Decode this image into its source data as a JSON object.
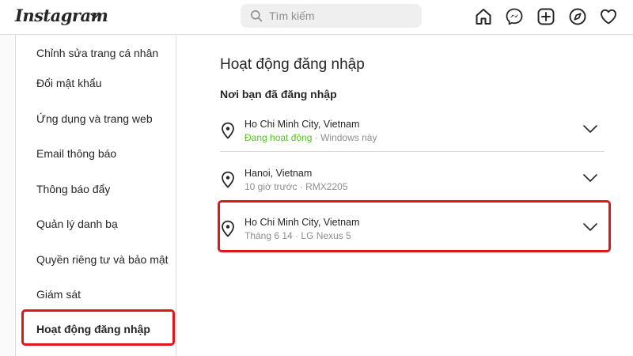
{
  "app": {
    "logo_text": "Instagram"
  },
  "search": {
    "placeholder": "Tìm kiếm"
  },
  "nav_icons": [
    "home-icon",
    "messenger-icon",
    "new-post-icon",
    "explore-icon",
    "activity-heart-icon"
  ],
  "sidebar": {
    "items": [
      {
        "label": "Chỉnh sửa trang cá nhân"
      },
      {
        "label": "Đổi mật khẩu"
      },
      {
        "label": "Ứng dụng và trang web"
      },
      {
        "label": "Email thông báo"
      },
      {
        "label": "Thông báo đẩy"
      },
      {
        "label": "Quản lý danh bạ"
      },
      {
        "label": "Quyền riêng tư và bảo mật"
      },
      {
        "label": "Giám sát"
      },
      {
        "label": "Hoạt động đăng nhập",
        "active": true
      }
    ]
  },
  "main": {
    "title": "Hoạt động đăng nhập",
    "subtitle": "Nơi bạn đã đăng nhập",
    "logins": [
      {
        "location": "Ho Chi Minh City, Vietnam",
        "status": "Đang hoạt động",
        "separator": " · ",
        "device": "Windows này"
      },
      {
        "location": "Hanoi, Vietnam",
        "time": "10 giờ trước",
        "separator": " · ",
        "device": "RMX2205"
      },
      {
        "location": "Ho Chi Minh City, Vietnam",
        "time": "Tháng 6 14",
        "separator": " · ",
        "device": "LG Nexus 5"
      }
    ]
  },
  "colors": {
    "highlight": "#e0161b",
    "active_status": "#58c322",
    "muted_text": "#8e8e8e",
    "border": "#dbdbdb"
  }
}
